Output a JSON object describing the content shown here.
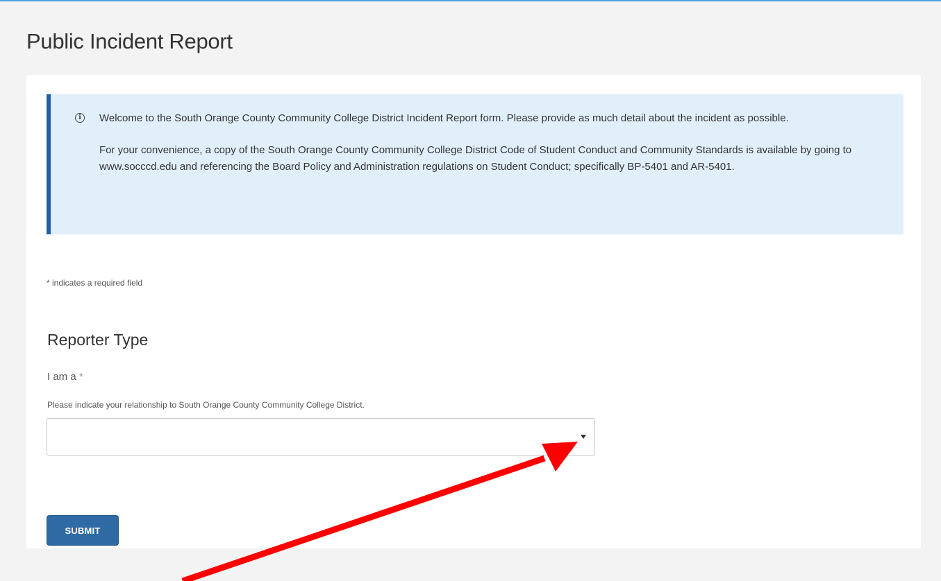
{
  "page": {
    "title": "Public Incident Report"
  },
  "info_alert": {
    "paragraph_1": "Welcome to the South Orange County Community College District Incident Report form. Please provide as much detail about the incident as possible.",
    "paragraph_2": "For your convenience, a copy of the South Orange County Community College District Code of Student Conduct and Community Standards is available by going to www.socccd.edu and referencing the Board Policy and Administration regulations on Student Conduct; specifically BP-5401 and AR-5401."
  },
  "form": {
    "required_note": "* indicates a required field",
    "section_title": "Reporter Type",
    "field": {
      "label": "I am a",
      "required_mark": "*",
      "help": "Please indicate your relationship to South Orange County Community College District.",
      "value": ""
    },
    "submit_label": "SUBMIT"
  },
  "colors": {
    "accent": "#2f6aa5",
    "alert_bg": "#e1effa",
    "alert_border": "#1f5fa8",
    "annotation_arrow": "#ff0000"
  },
  "icons": {
    "info": "info-icon",
    "dropdown": "chevron-down-icon"
  }
}
